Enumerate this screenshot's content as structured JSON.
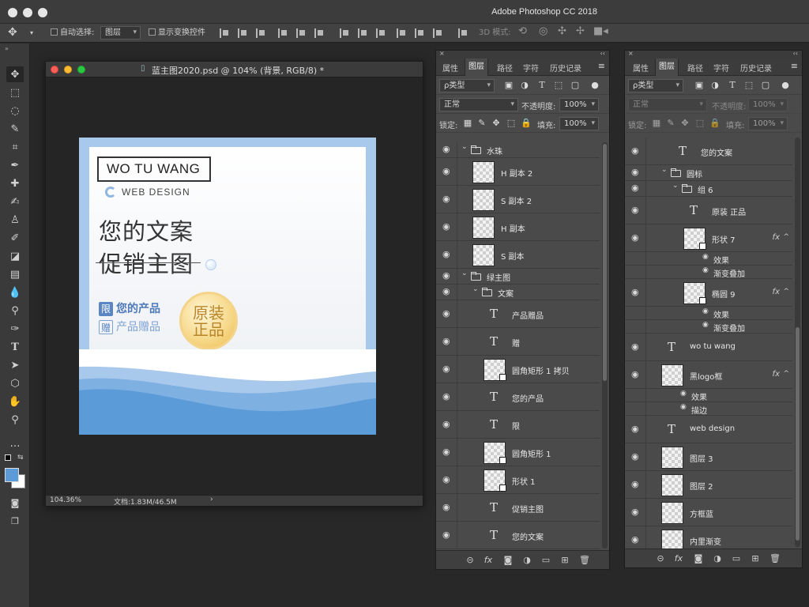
{
  "app": {
    "title": "Adobe Photoshop CC 2018"
  },
  "options_bar": {
    "auto_select_label": "自动选择:",
    "auto_select_value": "图层",
    "show_transform_label": "显示变换控件",
    "mode_3d_label": "3D 模式:"
  },
  "document": {
    "tab_title": "蓝主图2020.psd @ 104% (背景, RGB/8) *",
    "zoom": "104.36%",
    "doc_info": "文档:1.83M/46.5M",
    "artwork": {
      "logo_text": "WO TU WANG",
      "subtitle": "WEB DESIGN",
      "headline_1": "您的文案",
      "headline_2": "促销主图",
      "tag1_icon": "限",
      "tag1_text": "您的产品",
      "tag2_icon": "赠",
      "tag2_text": "产品赠品",
      "badge_line1": "原装",
      "badge_line2": "正品"
    }
  },
  "panel_a": {
    "tabs": [
      "属性",
      "图层",
      "路径",
      "字符",
      "历史记录"
    ],
    "filter_label": "ρ类型",
    "blend_mode": "正常",
    "opacity_label": "不透明度:",
    "opacity_value": "100%",
    "lock_label": "锁定:",
    "fill_label": "填充:",
    "fill_value": "100%",
    "layers": [
      {
        "kind": "folder",
        "name": "水珠",
        "indent": 0
      },
      {
        "kind": "thumb",
        "name": "H 副本 2",
        "indent": 0
      },
      {
        "kind": "thumb",
        "name": "S 副本 2",
        "indent": 0
      },
      {
        "kind": "thumb",
        "name": "H 副本",
        "indent": 0
      },
      {
        "kind": "thumb",
        "name": "S 副本",
        "indent": 0
      },
      {
        "kind": "folder",
        "name": "绿主图",
        "indent": 0
      },
      {
        "kind": "folder",
        "name": "文案",
        "indent": 1
      },
      {
        "kind": "text",
        "name": "产品赠品",
        "indent": 1
      },
      {
        "kind": "text",
        "name": "赠",
        "indent": 1
      },
      {
        "kind": "shape",
        "name": "圆角矩形 1 拷贝",
        "indent": 1
      },
      {
        "kind": "text",
        "name": "您的产品",
        "indent": 1
      },
      {
        "kind": "text",
        "name": "限",
        "indent": 1
      },
      {
        "kind": "shape",
        "name": "圆角矩形 1",
        "indent": 1
      },
      {
        "kind": "shape",
        "name": "形状 1",
        "indent": 1
      },
      {
        "kind": "text",
        "name": "促销主图",
        "indent": 1
      },
      {
        "kind": "text",
        "name": "您的文案",
        "indent": 1
      }
    ]
  },
  "panel_b": {
    "tabs": [
      "属性",
      "图层",
      "路径",
      "字符",
      "历史记录"
    ],
    "filter_label": "ρ类型",
    "blend_mode": "正常",
    "opacity_label": "不透明度:",
    "opacity_value": "100%",
    "lock_label": "锁定:",
    "fill_label": "填充:",
    "fill_value": "100%",
    "layers": [
      {
        "kind": "text",
        "name": "您的文案",
        "indent": 1
      },
      {
        "kind": "folder",
        "name": "圆标",
        "indent": 1
      },
      {
        "kind": "folder",
        "name": "组 6",
        "indent": 2
      },
      {
        "kind": "text",
        "name": "原装 正品",
        "indent": 2
      },
      {
        "kind": "shape",
        "name": "形状 7",
        "indent": 2,
        "fx": "fx"
      },
      {
        "kind": "effect-head",
        "name": "效果",
        "indent": 3
      },
      {
        "kind": "effect",
        "name": "渐变叠加",
        "indent": 3
      },
      {
        "kind": "shape",
        "name": "椭圆 9",
        "indent": 2,
        "fx": "fx"
      },
      {
        "kind": "effect-head",
        "name": "效果",
        "indent": 3
      },
      {
        "kind": "effect",
        "name": "渐变叠加",
        "indent": 3
      },
      {
        "kind": "text",
        "name": "wo tu wang",
        "indent": 0
      },
      {
        "kind": "thumb",
        "name": "黑logo框",
        "indent": 0,
        "fx": "fx"
      },
      {
        "kind": "effect-head",
        "name": "效果",
        "indent": 1
      },
      {
        "kind": "effect",
        "name": "描边",
        "indent": 1
      },
      {
        "kind": "text",
        "name": "web  design",
        "indent": 0
      },
      {
        "kind": "thumb",
        "name": "图层 3",
        "indent": 0
      },
      {
        "kind": "thumb",
        "name": "图层 2",
        "indent": 0
      },
      {
        "kind": "thumb",
        "name": "方框蓝",
        "indent": 0
      },
      {
        "kind": "thumb",
        "name": "内里渐变",
        "indent": 0
      }
    ]
  },
  "colors": {
    "accent_blue": "#5b9bd8",
    "badge_gold": "#f2cd6d"
  }
}
